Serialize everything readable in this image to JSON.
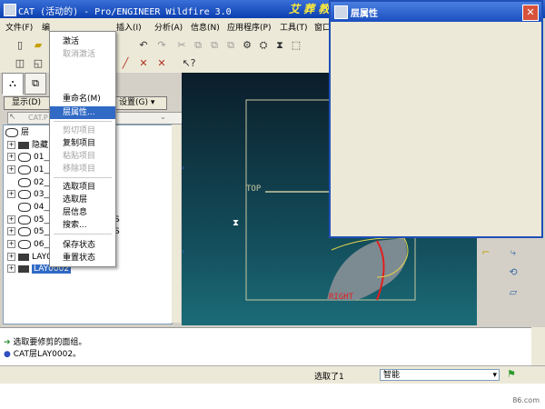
{
  "window": {
    "title": "CAT (活动的) - Pro/ENGINEER Wildfire 3.0",
    "watermark": "艾 葬 教 育"
  },
  "menubar": {
    "items": [
      "文件(F)",
      "编",
      "插入(I)",
      "分析(A)",
      "信息(N)",
      "应用程序(P)",
      "工具(T)",
      "窗口"
    ]
  },
  "layer_panel": {
    "show_label": "显示(D)",
    "settings_label": "设置(G) ▾",
    "combo_value": "CAT.P",
    "root_label": "层",
    "items": [
      "隐藏",
      "01__",
      "01__",
      "02__",
      "03__",
      "04__",
      "05__",
      "05__",
      "06__",
      "LAY0",
      "LAY0002"
    ],
    "items_right": [
      "S",
      "S"
    ]
  },
  "context_menu": {
    "items": [
      {
        "label": "激活",
        "disabled": false
      },
      {
        "label": "取消激活",
        "disabled": true
      },
      {
        "label": "重命名(M)",
        "disabled": false
      },
      {
        "label": "层属性...",
        "disabled": false,
        "highlight": true
      },
      {
        "label": "剪切项目",
        "disabled": true
      },
      {
        "label": "复制项目",
        "disabled": false
      },
      {
        "label": "粘贴项目",
        "disabled": true
      },
      {
        "label": "移除项目",
        "disabled": true
      },
      {
        "label": "选取项目",
        "disabled": false
      },
      {
        "label": "选取层",
        "disabled": false
      },
      {
        "label": "层信息",
        "disabled": false
      },
      {
        "label": "搜索...",
        "disabled": false
      },
      {
        "label": "保存状态",
        "disabled": false
      },
      {
        "label": "重置状态",
        "disabled": false
      }
    ]
  },
  "dialog": {
    "title": "层属性",
    "close": "✕"
  },
  "canvas": {
    "label_top": "TOP",
    "label_right": "RIGHT"
  },
  "messages": [
    "选取要修剪的面组。",
    "CAT层LAY0002。"
  ],
  "status": {
    "selection": "选取了1",
    "filter": "智能"
  },
  "footer": {
    "text": "86.com"
  },
  "colors": {
    "titlebar": "#0a3fb0",
    "highlight": "#316ac5",
    "canvas_top": "#0b1d2a",
    "canvas_bottom": "#1b6c78",
    "datum": "#c8c8a0",
    "curve_red": "#e02020",
    "curve_yellow": "#e6d84a"
  }
}
